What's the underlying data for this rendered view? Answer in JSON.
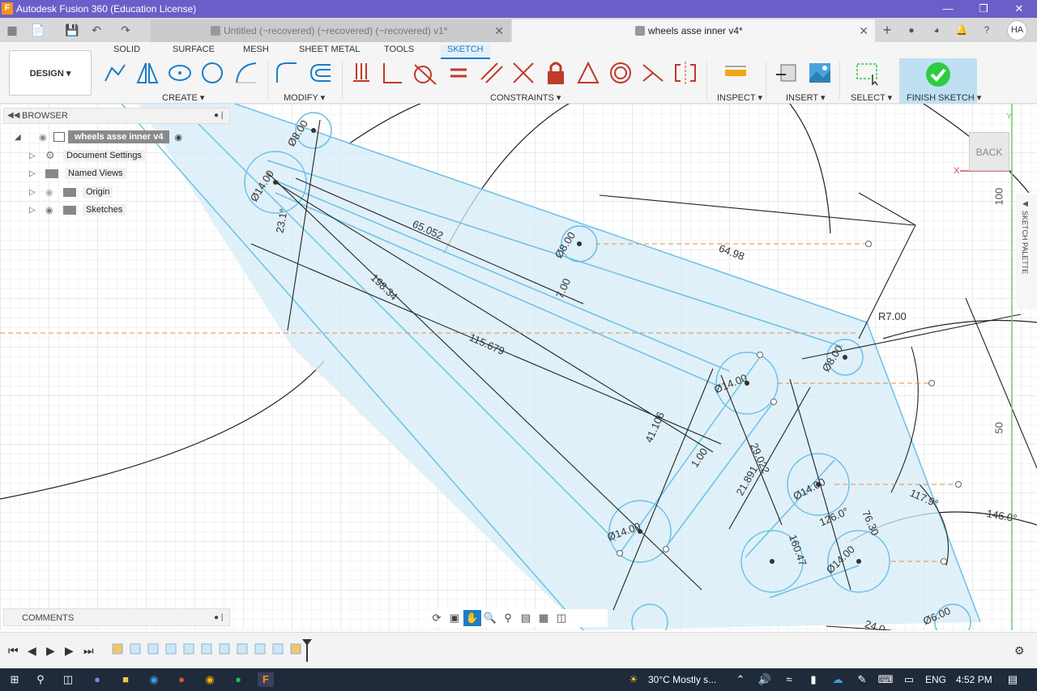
{
  "app": {
    "title": "Autodesk Fusion 360 (Education License)",
    "logo_letter": "F",
    "colors": {
      "titlebar": "#6a5fc8",
      "accent": "#1a7ec8",
      "sketch_blue": "#6cc0e5",
      "finish_green": "#2ecc40"
    }
  },
  "tabs": [
    {
      "label": "Untitled (~recovered) (~recovered) (~recovered) v1*",
      "active": false
    },
    {
      "label": "wheels asse inner v4*",
      "active": true
    }
  ],
  "user": {
    "initials": "HA"
  },
  "workspace": {
    "label": "DESIGN"
  },
  "toolbar_tabs": [
    "SOLID",
    "SURFACE",
    "MESH",
    "SHEET METAL",
    "TOOLS",
    "SKETCH"
  ],
  "groups": {
    "create": "CREATE",
    "modify": "MODIFY",
    "constraints": "CONSTRAINTS",
    "inspect": "INSPECT",
    "insert": "INSERT",
    "select": "SELECT",
    "finish": "FINISH SKETCH"
  },
  "browser": {
    "header": "BROWSER",
    "root": "wheels asse inner v4",
    "items": [
      "Document Settings",
      "Named Views",
      "Origin",
      "Sketches"
    ]
  },
  "comments": {
    "header": "COMMENTS"
  },
  "viewcube": {
    "face": "BACK",
    "axis_x": "X",
    "axis_y": "Y"
  },
  "palette": {
    "label": "SKETCH PALETTE"
  },
  "ruler": [
    "100",
    "50"
  ],
  "dimensions": [
    "Ø8.00",
    "Ø14.00",
    "23.1°",
    "65.052",
    "198.34",
    "Ø8.00",
    "64.98",
    "7.00",
    "115.679",
    "R7.00",
    "Ø8.00",
    "Ø14.00",
    "41.106",
    "29.022",
    "1.00",
    "21.891",
    "Ø14.00",
    "Ø14.00",
    "126.0°",
    "117.9°",
    "146.0°",
    "76.30",
    "160.47",
    "Ø14.00",
    "Ø6.00",
    "24.0"
  ],
  "taskbar": {
    "weather": "30°C  Mostly s...",
    "lang": "ENG",
    "time": "4:52 PM"
  }
}
